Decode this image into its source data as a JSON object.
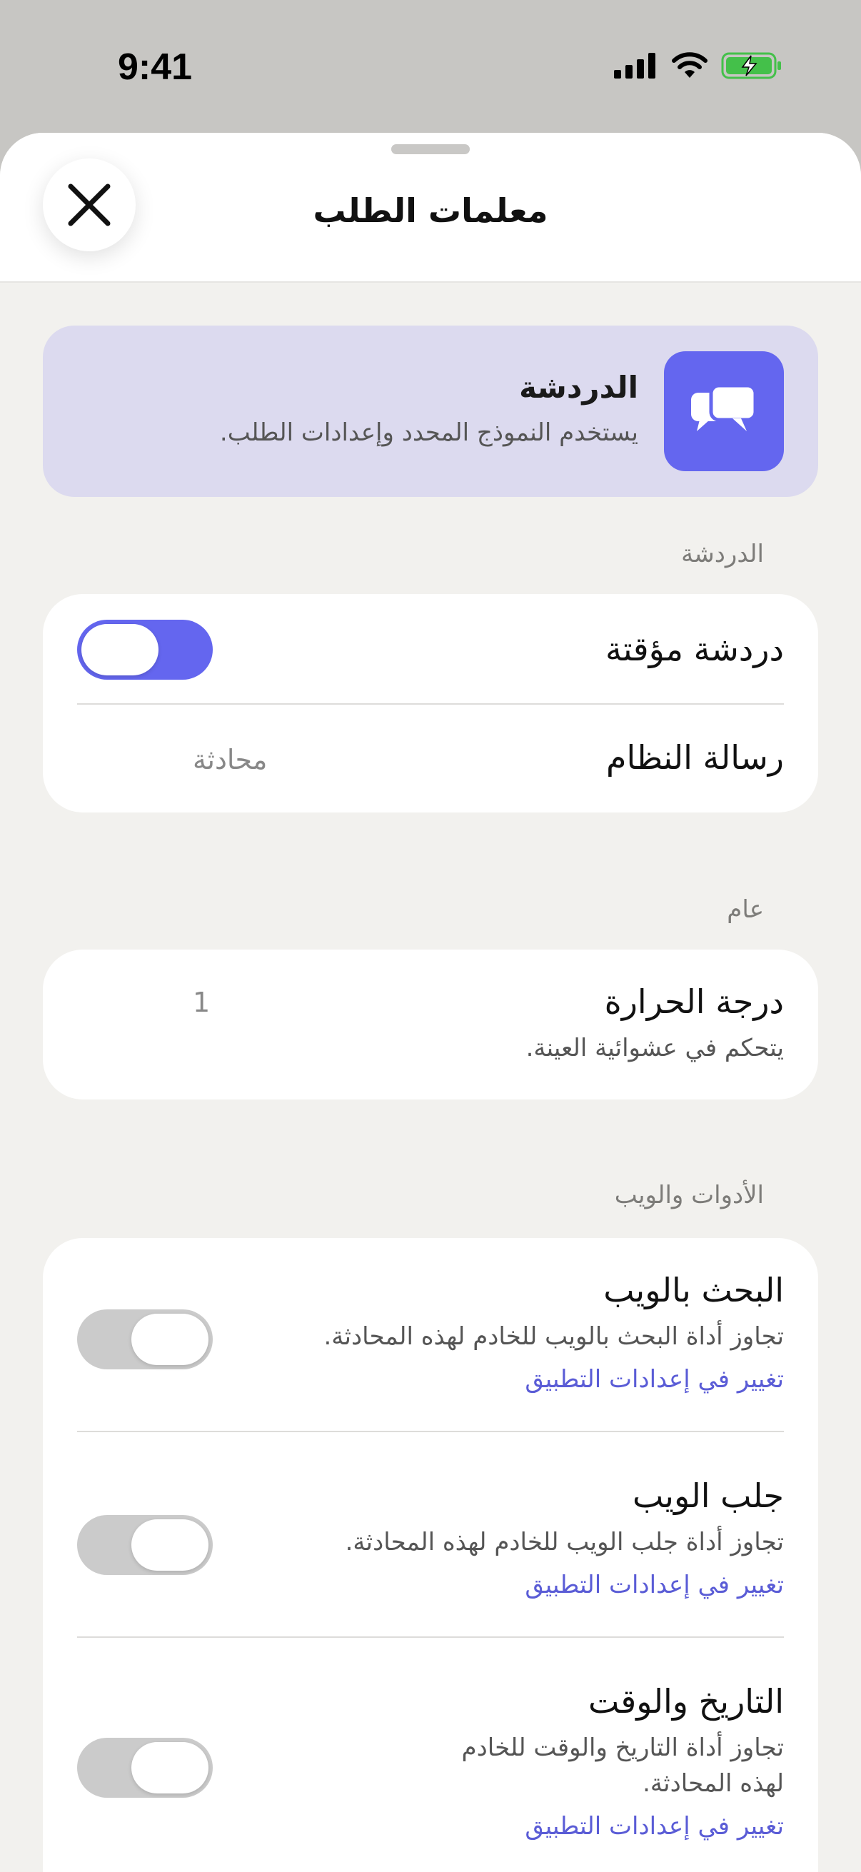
{
  "status_bar": {
    "time": "9:41"
  },
  "sheet": {
    "title": "معلمات الطلب"
  },
  "banner": {
    "title": "الدردشة",
    "subtitle": "يستخدم النموذج المحدد وإعدادات الطلب.",
    "accent": "#6466ef"
  },
  "chat_section": {
    "label": "الدردشة",
    "temporary_chat": {
      "label": "دردشة مؤقتة",
      "enabled": true
    },
    "system_message": {
      "label": "رسالة النظام",
      "value": "محادثة"
    }
  },
  "general_section": {
    "label": "عام",
    "temperature": {
      "label": "درجة الحرارة",
      "description": "يتحكم في عشوائية العينة.",
      "value": "1"
    }
  },
  "tools_section": {
    "label": "الأدوات والويب",
    "items": [
      {
        "title": "البحث بالويب",
        "description": "تجاوز أداة البحث بالويب للخادم لهذه المحادثة.",
        "link": "تغيير في إعدادات التطبيق",
        "enabled": false
      },
      {
        "title": "جلب الويب",
        "description": "تجاوز أداة جلب الويب للخادم لهذه المحادثة.",
        "link": "تغيير في إعدادات التطبيق",
        "enabled": false
      },
      {
        "title": "التاريخ والوقت",
        "description_line1": "تجاوز أداة التاريخ والوقت للخادم",
        "description_line2": "لهذه المحادثة.",
        "link": "تغيير في إعدادات التطبيق",
        "enabled": false
      }
    ]
  }
}
